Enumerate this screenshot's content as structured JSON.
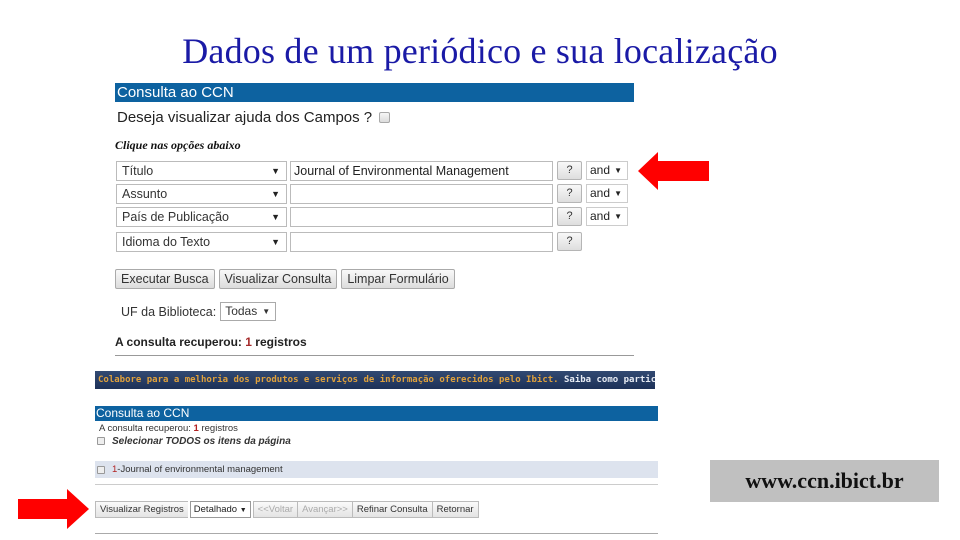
{
  "slide": {
    "title": "Dados de um periódico e sua localização",
    "url": "www.ccn.ibict.br",
    "arrow_color": "#ff0000",
    "title_color": "#1a1aa6"
  },
  "search_form": {
    "header": "Consulta ao CCN",
    "header_color": "#0d62a0",
    "help_label": "Deseja visualizar ajuda dos Campos ?",
    "help_checked": false,
    "instruction": "Clique nas opções abaixo",
    "fields": [
      {
        "field": "Título",
        "value": "Journal of Environmental Management",
        "help": "?",
        "operator": "and"
      },
      {
        "field": "Assunto",
        "value": "",
        "help": "?",
        "operator": "and"
      },
      {
        "field": "País de Publicação",
        "value": "",
        "help": "?",
        "operator": "and"
      },
      {
        "field": "Idioma do Texto",
        "value": "",
        "help": "?",
        "operator": null
      }
    ],
    "buttons": {
      "execute": "Executar Busca",
      "preview": "Visualizar Consulta",
      "clear": "Limpar Formulário"
    },
    "uf_label": "UF da Biblioteca:",
    "uf_value": "Todas",
    "result_prefix": "A consulta recuperou:",
    "result_count": "1",
    "result_suffix": "registros"
  },
  "banner": {
    "text_orange": "Colabore para a melhoria dos produtos e serviços de informação oferecidos pelo Ibict.",
    "text_white": "Saiba como participar:",
    "flags": [
      "brazil-flag",
      "spain-flag",
      "usa-flag"
    ]
  },
  "results_panel": {
    "header": "Consulta ao CCN",
    "result_prefix": "A consulta recuperou:",
    "result_count": "1",
    "result_suffix": "registros",
    "select_all_label": "Selecionar TODOS os itens da página",
    "records": [
      {
        "number": "1",
        "title": "-Journal of environmental management"
      }
    ],
    "toolbar": {
      "view_records": "Visualizar Registros",
      "format_value": "Detalhado",
      "back": "<<Voltar",
      "forward": "Avançar>>",
      "refine": "Refinar Consulta",
      "return": "Retornar"
    }
  }
}
